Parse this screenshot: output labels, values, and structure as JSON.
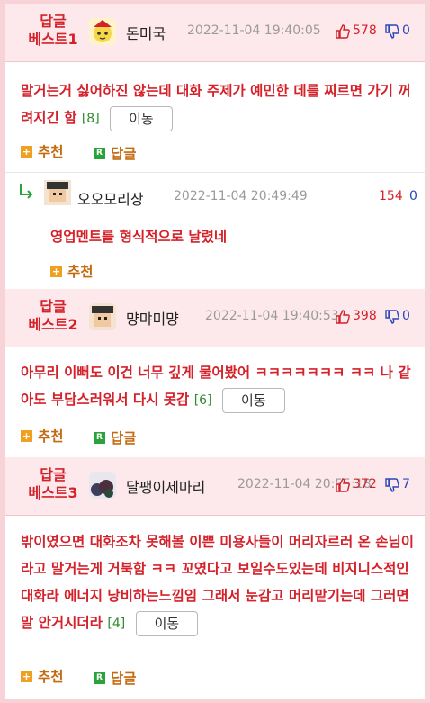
{
  "posts": [
    {
      "best_label": "답글\n베스트1",
      "nick": "돈미국",
      "date": "2022-11-04 19:40:05",
      "up": "578",
      "down": "0",
      "text": "말거는거 싫어하진 않는데 대화 주제가 예민한 데를 찌르면 가기 꺼려지긴 함",
      "reply_count": "[8]",
      "move_label": "이동",
      "recommend_label": "추천",
      "reply_label": "답글",
      "colors": {
        "best": "#d4212a"
      }
    },
    {
      "best_label": "답글\n베스트2",
      "nick": "먕먀미먕",
      "date": "2022-11-04 19:40:53",
      "up": "398",
      "down": "0",
      "text": "아무리 이뻐도 이건 너무 깊게 물어봤어 ㅋㅋㅋㅋㅋㅋㅋ ㅋㅋ 나 같아도 부담스러워서 다시 못감",
      "reply_count": "[6]",
      "move_label": "이동",
      "recommend_label": "추천",
      "reply_label": "답글"
    },
    {
      "best_label": "답글\n베스트3",
      "nick": "달팽이세마리",
      "date": "2022-11-04 20:55:18",
      "up": "372",
      "down": "7",
      "text": "밖이였으면 대화조차 못해볼 이쁜 미용사들이 머리자르러 온 손님이라고 말거는게 거북함 ㅋㅋ 꼬였다고 보일수도있는데 비지니스적인 대화라 에너지 낭비하는느낌임 그래서 눈감고 머리맡기는데 그러면 말 안거시더라",
      "reply_count": "[4]",
      "move_label": "이동",
      "recommend_label": "추천",
      "reply_label": "답글"
    }
  ],
  "reply": {
    "nick": "오오모리상",
    "date": "2022-11-04 20:49:49",
    "up": "154",
    "down": "0",
    "text": "영업멘트를 형식적으로 날렸네",
    "recommend_label": "추천",
    "arrow_icon": "reply-arrow-icon"
  }
}
